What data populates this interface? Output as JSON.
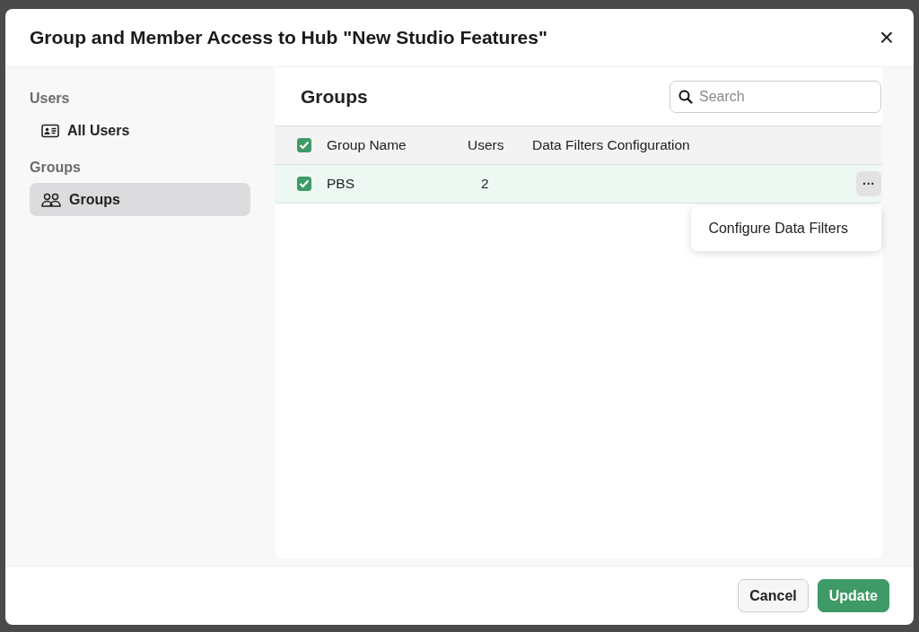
{
  "dialog": {
    "title": "Group and Member Access to Hub \"New Studio Features\"",
    "close": "×"
  },
  "sidebar": {
    "sections": [
      {
        "heading": "Users",
        "items": [
          {
            "label": "All Users",
            "selected": false
          }
        ]
      },
      {
        "heading": "Groups",
        "items": [
          {
            "label": "Groups",
            "selected": true
          }
        ]
      }
    ]
  },
  "panel": {
    "title": "Groups",
    "search": {
      "placeholder": "Search"
    }
  },
  "table": {
    "all_checked": true,
    "columns": [
      "Group Name",
      "Users",
      "Data Filters Configuration"
    ],
    "rows": [
      {
        "checked": true,
        "group_name": "PBS",
        "users": "2",
        "menu_open": true
      }
    ]
  },
  "row_menu": {
    "button": "···",
    "items": [
      "Configure Data Filters"
    ]
  },
  "buttons": [
    {
      "label": "Cancel",
      "kind": "secondary"
    },
    {
      "label": "Update",
      "kind": "primary"
    }
  ]
}
